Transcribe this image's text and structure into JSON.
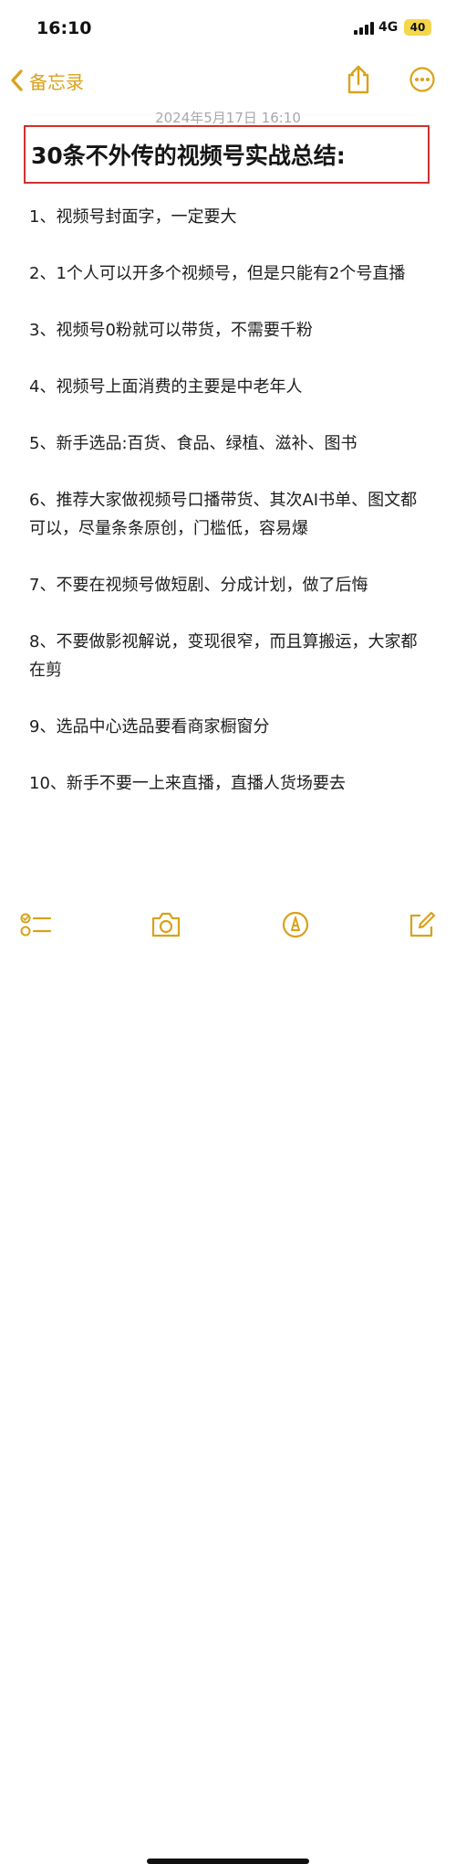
{
  "status_bar": {
    "time": "16:10",
    "network": "4G",
    "battery": "40"
  },
  "nav": {
    "back_label": "备忘录"
  },
  "note": {
    "date": "2024年5月17日 16:10",
    "title": "30条不外传的视频号实战总结:",
    "paragraphs": [
      "1、视频号封面字，一定要大",
      "2、1个人可以开多个视频号，但是只能有2个号直播",
      "3、视频号0粉就可以带货，不需要千粉",
      "4、视频号上面消费的主要是中老年人",
      "5、新手选品:百货、食品、绿植、滋补、图书",
      "6、推荐大家做视频号口播带货、其次AI书单、图文都可以，尽量条条原创，门槛低，容易爆",
      "7、不要在视频号做短剧、分成计划，做了后悔",
      "8、不要做影视解说，变现很窄，而且算搬运，大家都在剪",
      "9、选品中心选品要看商家橱窗分",
      "10、新手不要一上来直播，直播人货场要去"
    ]
  },
  "colors": {
    "accent": "#d9a21a",
    "highlight_border": "#d0302e",
    "battery": "#f4d64b"
  },
  "icons": [
    "chevron-left-icon",
    "share-icon",
    "more-icon",
    "checklist-icon",
    "camera-icon",
    "markup-icon",
    "compose-icon"
  ]
}
